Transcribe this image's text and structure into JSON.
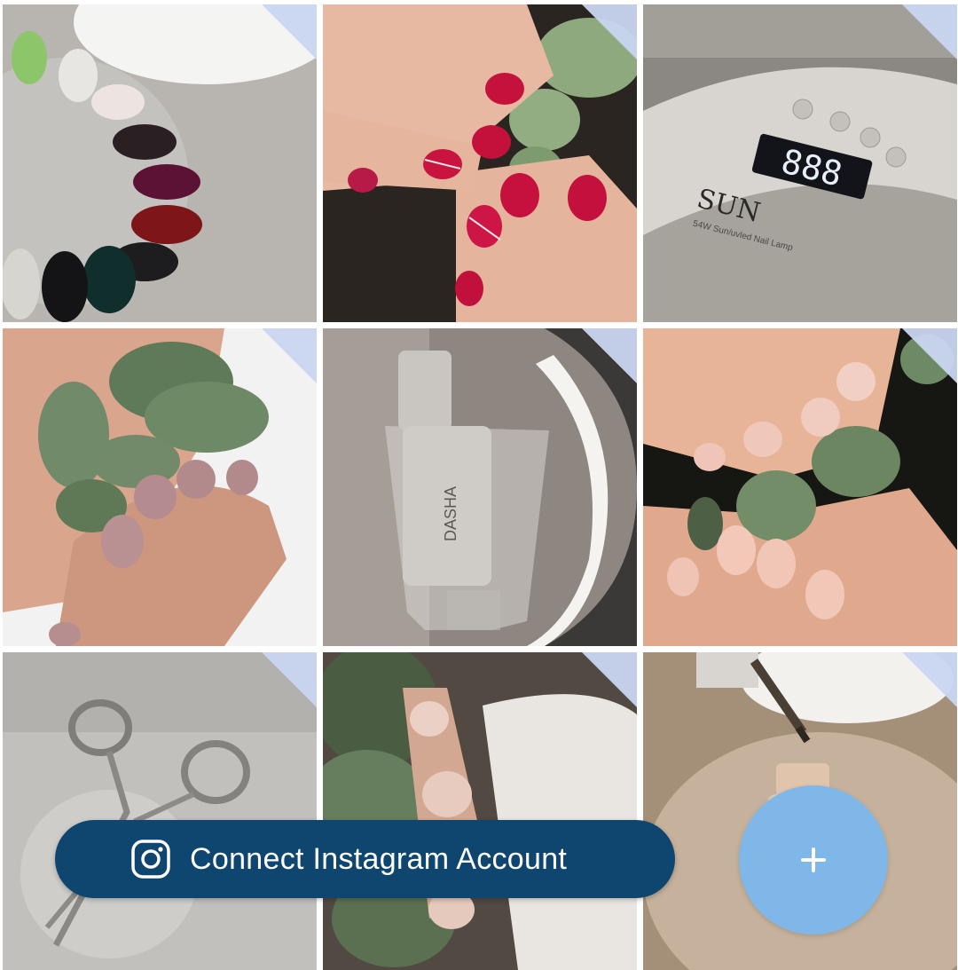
{
  "grid": {
    "tiles": [
      {
        "subject": "nail polish swatch wheel"
      },
      {
        "subject": "red manicure with eucalyptus"
      },
      {
        "subject": "SUN X nail lamp",
        "lamp_brand": "SUN",
        "lamp_model": "54W Sun/uvled Nail Lamp",
        "display": "888"
      },
      {
        "subject": "mauve nails with eucalyptus"
      },
      {
        "subject": "gel polish bottle in glass",
        "bottle_brand": "DASHA"
      },
      {
        "subject": "nude manicure with eucalyptus"
      },
      {
        "subject": "cuticle scissors in glass"
      },
      {
        "subject": "nude nails holding eucalyptus"
      },
      {
        "subject": "polish brush over bottle"
      }
    ]
  },
  "connect_button": {
    "label": "Connect Instagram Account",
    "icon": "instagram-icon",
    "color": "#0e4670"
  },
  "fab": {
    "icon": "plus-icon",
    "color": "#7fb7e8"
  },
  "corner_marker_color": "#c9d6f1"
}
